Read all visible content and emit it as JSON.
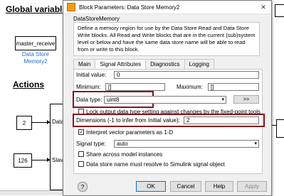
{
  "canvas": {
    "global_heading": "Global variables",
    "actions_heading": "Actions",
    "data_store_block_text": "master_receive",
    "data_store_link": "Data Store\nMemory2",
    "const1_value": "2",
    "const2_value": "126",
    "port_label_1": "Data Siz",
    "port_label_2": "Slave Ad"
  },
  "dialog": {
    "title": "Block Parameters: Data Store Memory2",
    "block_type": "DataStoreMemory",
    "description": "Define a memory region for use by the Data Store Read and Data Store Write blocks. All Read and Write blocks that are in the current (sub)system level or below and have the same data store name will be able to read from or write to this block.",
    "tabs": [
      "Main",
      "Signal Attributes",
      "Diagnostics",
      "Logging"
    ],
    "initial_value_label": "Initial value:",
    "initial_value": "0",
    "minimum_label": "Minimum:",
    "minimum_value": "[]",
    "maximum_label": "Maximum:",
    "maximum_value": "[]",
    "data_type_label": "Data type:",
    "data_type_value": "uint8",
    "data_type_assistant_label": ">>",
    "lock_label": "Lock output data type setting against changes by the fixed-point tools",
    "dimensions_label": "Dimensions (-1 to infer from Initial value):",
    "dimensions_value": "2",
    "interpret_vector_label": "Interpret vector parameters as 1-D",
    "signal_type_label": "Signal type:",
    "signal_type_value": "auto",
    "share_label": "Share across model instances",
    "resolve_label": "Data store name must resolve to Simulink signal object",
    "buttons": {
      "ok": "OK",
      "cancel": "Cancel",
      "help": "Help",
      "apply": "Apply"
    },
    "colors": {
      "highlight": "#8b0f1a",
      "link": "#1f6fd1"
    }
  }
}
